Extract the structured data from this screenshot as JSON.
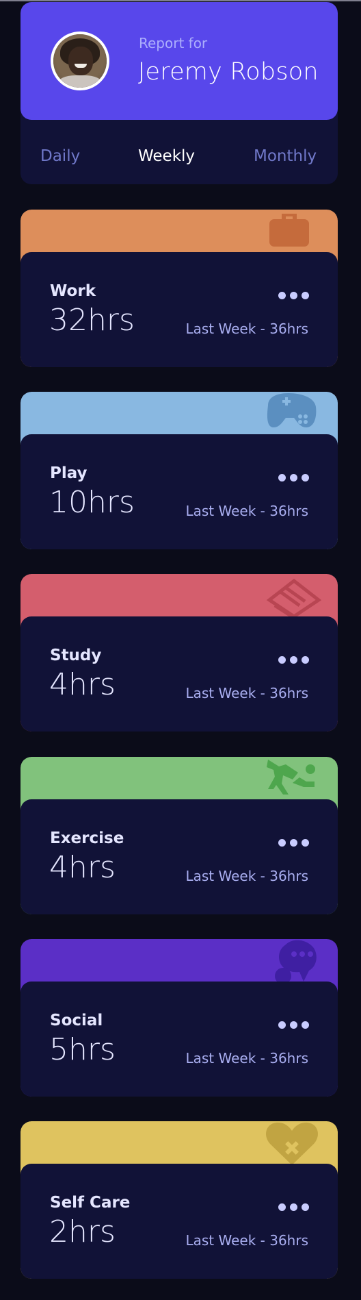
{
  "profile": {
    "report_label": "Report for",
    "name": "Jeremy Robson"
  },
  "tabs": [
    {
      "label": "Daily",
      "active": false
    },
    {
      "label": "Weekly",
      "active": true
    },
    {
      "label": "Monthly",
      "active": false
    }
  ],
  "activities": [
    {
      "title": "Work",
      "current": "32hrs",
      "previous": "Last Week - 36hrs",
      "color": "#dd8e5b",
      "icon": "briefcase-icon"
    },
    {
      "title": "Play",
      "current": "10hrs",
      "previous": "Last Week - 36hrs",
      "color": "#89b8e1",
      "icon": "gamepad-icon"
    },
    {
      "title": "Study",
      "current": "4hrs",
      "previous": "Last Week - 36hrs",
      "color": "#d45e6d",
      "icon": "book-icon"
    },
    {
      "title": "Exercise",
      "current": "4hrs",
      "previous": "Last Week - 36hrs",
      "color": "#81c27c",
      "icon": "running-icon"
    },
    {
      "title": "Social",
      "current": "5hrs",
      "previous": "Last Week - 36hrs",
      "color": "#5b2fc6",
      "icon": "chat-icon"
    },
    {
      "title": "Self Care",
      "current": "2hrs",
      "previous": "Last Week - 36hrs",
      "color": "#dfc35f",
      "icon": "heart-icon"
    }
  ],
  "colors": {
    "page_bg": "#0b0c19",
    "card_bg": "#111237",
    "profile_bg": "#5847eb",
    "muted_text": "#7078c9"
  }
}
